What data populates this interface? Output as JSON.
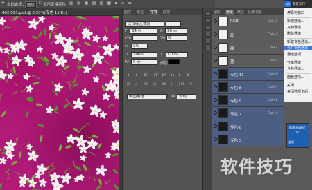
{
  "options_bar": {
    "auto_select": "自动选择：",
    "layer_select": "图层",
    "show_transform": "显示变换控件"
  },
  "document_tab": "402.095.psd @ 8.33%(专色 11/8..)",
  "char_panel": {
    "tabs": [
      "图层",
      "路径",
      "字符",
      "段落"
    ],
    "active_tab": 2,
    "font_family": "汉仪综艺体简",
    "font_size": "84 点",
    "leading": "36 点",
    "tracking": "0",
    "kerning": "0%",
    "vertical_scale": "100%",
    "horizontal_scale": "100%",
    "baseline_shift": "0 点",
    "color_label": "颜色：",
    "style_buttons": [
      "T",
      "T",
      "TT",
      "Tr",
      "T¹",
      "T₁",
      "T",
      "T"
    ],
    "language": "美国英语",
    "aa_label": "aa",
    "antialias": "锐利"
  },
  "channels_panel": {
    "tabs": [
      "图层",
      "通道",
      "路径",
      "历史记录"
    ],
    "active_tab": 1,
    "channels": [
      {
        "name": "RGB",
        "shortcut": "Ctrl+2",
        "thumb": "wht",
        "selected": false
      },
      {
        "name": "红",
        "shortcut": "Ctrl+3",
        "thumb": "wht",
        "selected": false
      },
      {
        "name": "绿",
        "shortcut": "Ctrl+4",
        "thumb": "wht",
        "selected": false
      },
      {
        "name": "蓝",
        "shortcut": "Ctrl+5",
        "thumb": "wht",
        "selected": false
      },
      {
        "name": "专色 11",
        "shortcut": "Ctrl+6",
        "thumb": "dark",
        "selected": true
      },
      {
        "name": "专色 8",
        "shortcut": "Ctrl+7",
        "thumb": "dark",
        "selected": true
      },
      {
        "name": "专色 9",
        "shortcut": "Ctrl+8",
        "thumb": "dark",
        "selected": true
      },
      {
        "name": "专色 7",
        "shortcut": "Ctrl+9",
        "thumb": "dark",
        "selected": true
      },
      {
        "name": "专色 6",
        "shortcut": "",
        "thumb": "dark",
        "selected": true
      },
      {
        "name": "专色 5",
        "shortcut": "",
        "thumb": "dark",
        "selected": true
      }
    ]
  },
  "context_menu": {
    "items": [
      "停靠到窗口",
      "新建通道...",
      "复制通道...",
      "删除通道",
      "新建专色通道...",
      "合并专色通道",
      "通道选项...",
      "分离通道",
      "合并通道...",
      "面板选项...",
      "关闭",
      "关闭选项卡组"
    ],
    "highlighted": 5
  },
  "top_right": {
    "logo": "ps",
    "label": "我在工作"
  },
  "teamviewer": {
    "title": "TeamViewer",
    "version": "12",
    "sub": "会话"
  },
  "watermark": "软件技巧"
}
